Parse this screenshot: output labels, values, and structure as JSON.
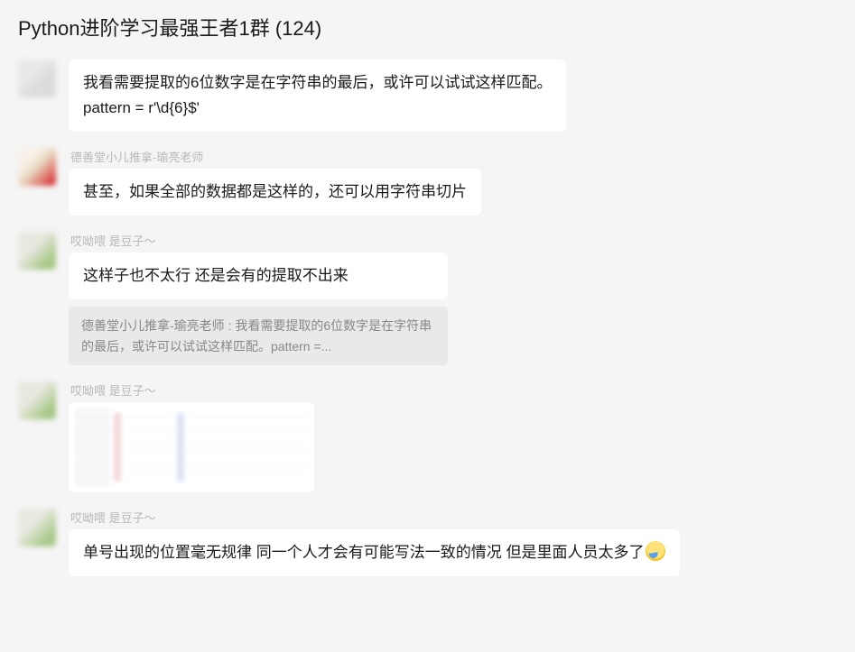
{
  "header": {
    "title": "Python进阶学习最强王者1群 (124)"
  },
  "messages": [
    {
      "avatar_class": "av1",
      "sender": "",
      "bubble": "我看需要提取的6位数字是在字符串的最后，或许可以试试这样匹配。\npattern = r'\\d{6}$'"
    },
    {
      "avatar_class": "av2",
      "sender": "德善堂小儿推拿-瑜亮老师",
      "bubble": "甚至，如果全部的数据都是这样的，还可以用字符串切片"
    },
    {
      "avatar_class": "av3",
      "sender": "哎呦喂  是豆子～",
      "bubble": "这样子也不太行  还是会有的提取不出来",
      "quote": "德善堂小儿推拿-瑜亮老师 : 我看需要提取的6位数字是在字符串的最后，或许可以试试这样匹配。pattern =..."
    },
    {
      "avatar_class": "av3",
      "sender": "哎呦喂  是豆子～",
      "image": true
    },
    {
      "avatar_class": "av3",
      "sender": "哎呦喂  是豆子～",
      "bubble_html": "单号出现的位置毫无规律  同一个人才会有可能写法一致的情况  但是里面人员太多了",
      "emoji": "smirk-sweat"
    }
  ]
}
